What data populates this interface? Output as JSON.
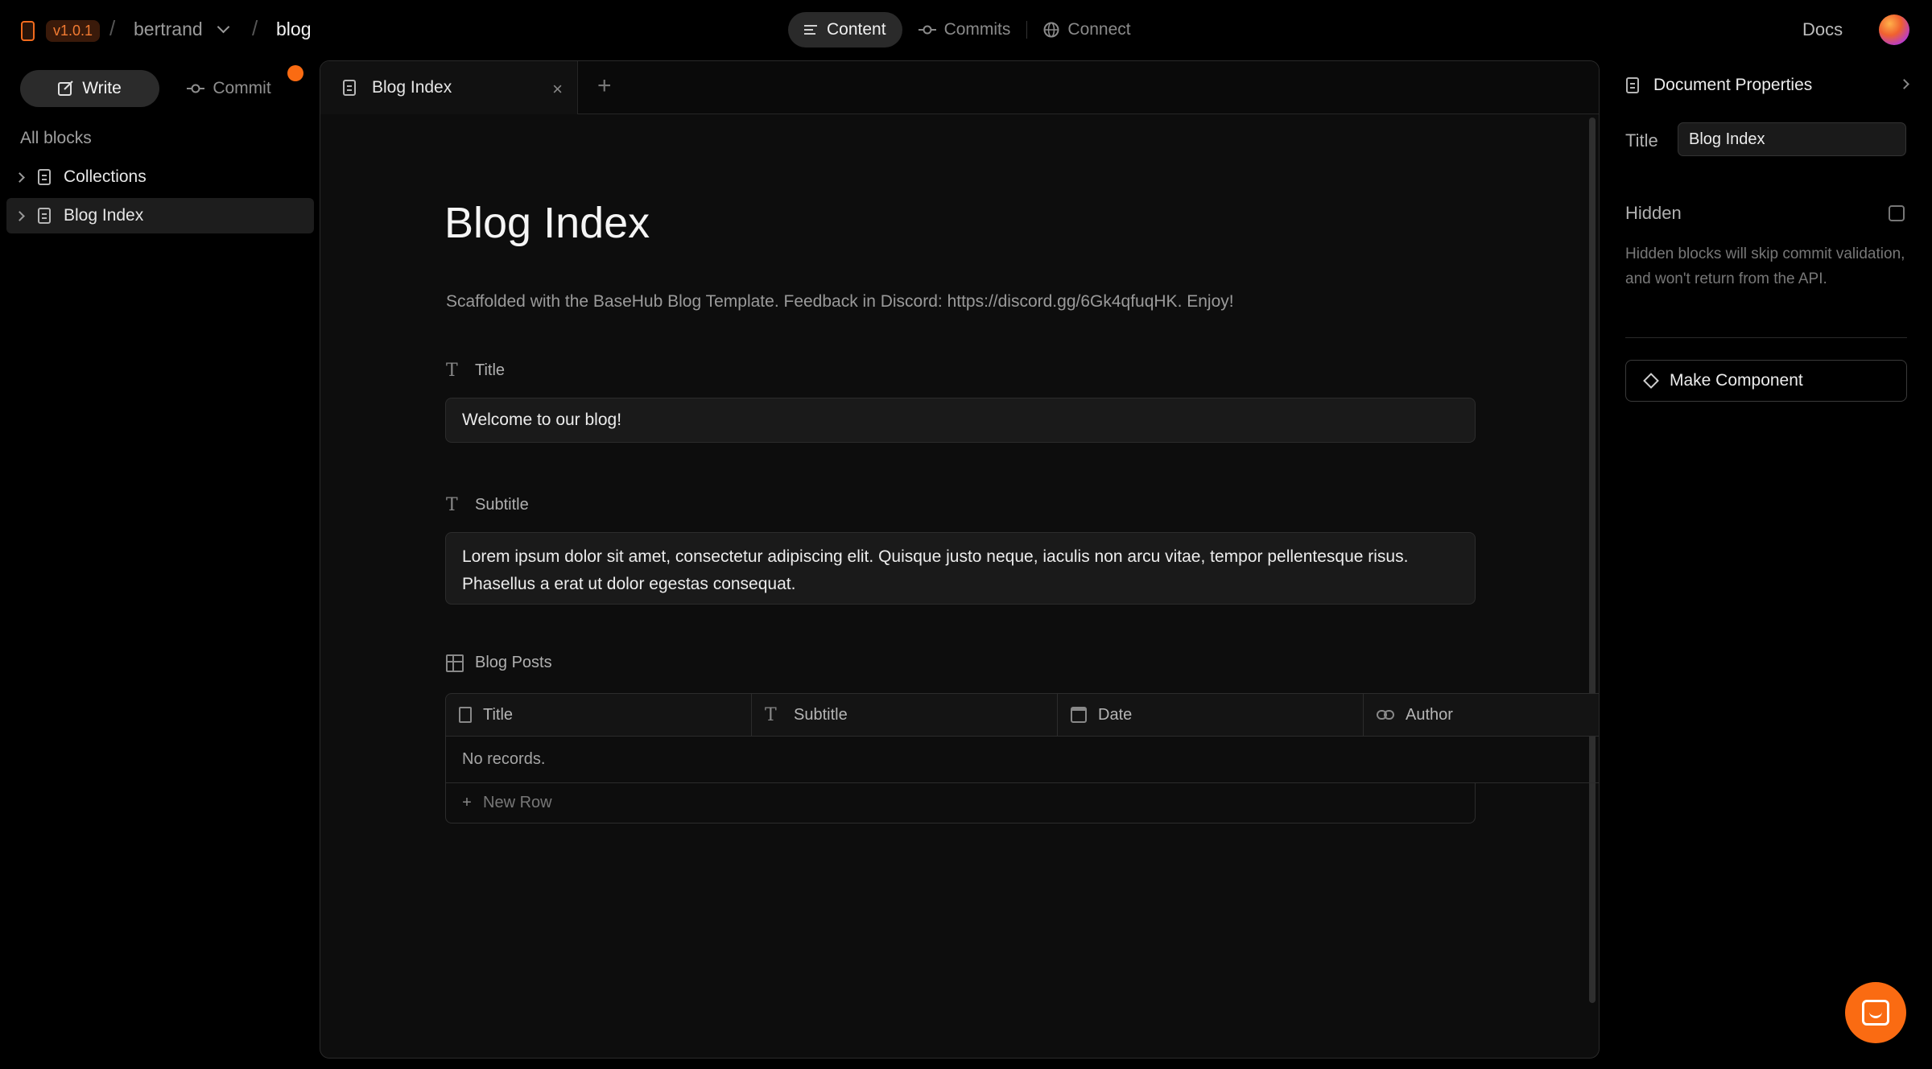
{
  "topbar": {
    "version": "v1.0.1",
    "team": "bertrand",
    "repo": "blog",
    "separator": "/",
    "modes": [
      {
        "label": "Content",
        "icon": "lines-icon"
      },
      {
        "label": "Commits",
        "icon": "commit-icon"
      },
      {
        "label": "Connect",
        "icon": "globe-icon"
      }
    ],
    "docs": "Docs"
  },
  "sidebar": {
    "write": "Write",
    "commit": "Commit",
    "section": "All blocks",
    "items": [
      {
        "label": "Collections"
      },
      {
        "label": "Blog Index"
      }
    ]
  },
  "editor": {
    "tab": "Blog Index",
    "tab_close": "×",
    "tab_add": "+",
    "title": "Blog Index",
    "description": "Scaffolded with the BaseHub Blog Template. Feedback in Discord: https://discord.gg/6Gk4qfuqHK. Enjoy!",
    "fields": {
      "title_label": "Title",
      "title_value": "Welcome to our blog!",
      "subtitle_label": "Subtitle",
      "subtitle_value": "Lorem ipsum dolor sit amet, consectetur adipiscing elit. Quisque justo neque, iaculis non arcu vitae, tempor pellentesque risus. Phasellus a erat ut dolor egestas consequat."
    },
    "collection": {
      "label": "Blog Posts",
      "columns": [
        "Title",
        "Subtitle",
        "Date",
        "Author"
      ],
      "empty": "No records.",
      "new_row": "New Row"
    }
  },
  "properties": {
    "header": "Document Properties",
    "title_label": "Title",
    "title_value": "Blog Index",
    "hidden_label": "Hidden",
    "hidden_help": "Hidden blocks will skip commit validation, and won't return from the API.",
    "make_component": "Make Component"
  },
  "colors": {
    "accent": "#fa6b12",
    "background": "#000000",
    "panel": "#0d0d0d"
  }
}
